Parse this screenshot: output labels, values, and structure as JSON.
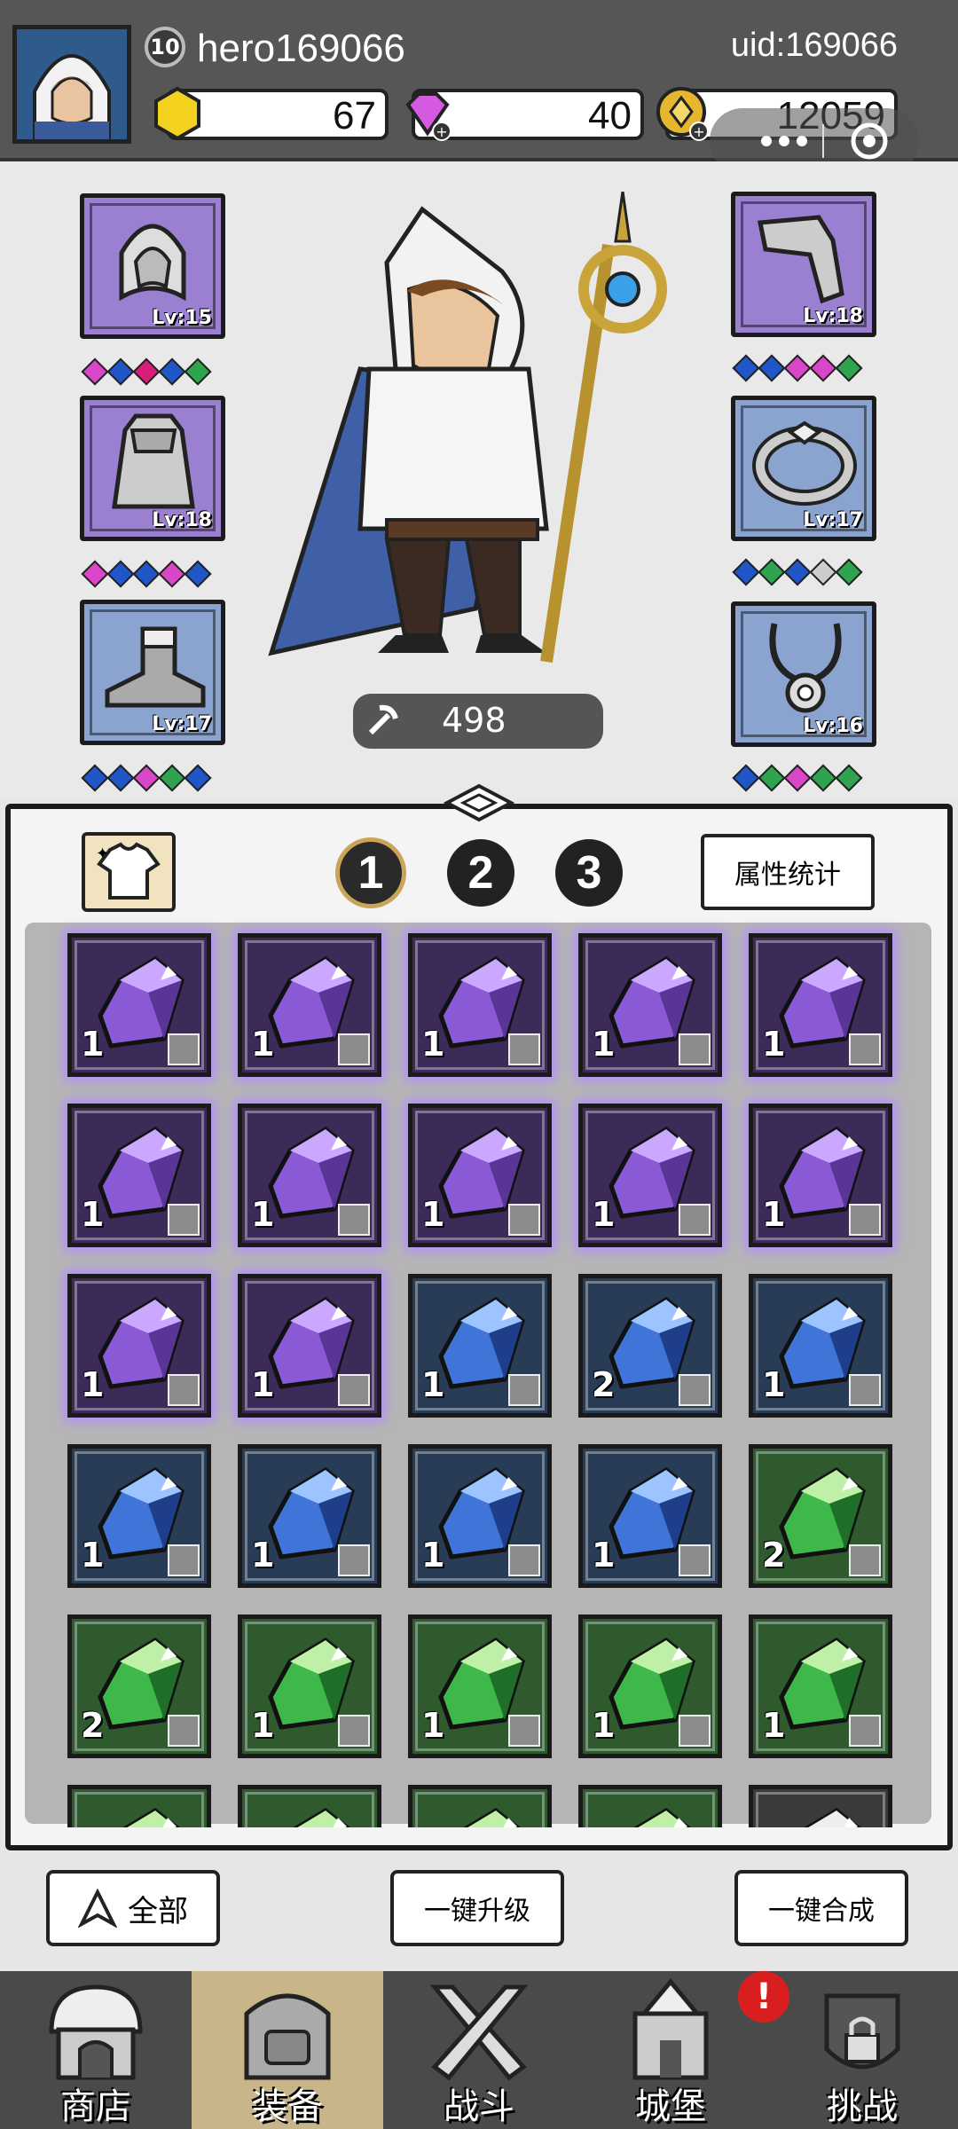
{
  "player": {
    "level": "10",
    "name": "hero169066",
    "uid": "uid:169066"
  },
  "resources": {
    "gold": "67",
    "gems": "40",
    "coins": "12059"
  },
  "equipment": {
    "left": [
      {
        "name": "hood",
        "level": "Lv:15",
        "gems": [
          "#d946c7",
          "#2156c9",
          "#d91e7a",
          "#2156c9",
          "#2ea44f"
        ]
      },
      {
        "name": "cape",
        "level": "Lv:18",
        "gems": [
          "#d946c7",
          "#2156c9",
          "#2156c9",
          "#d946c7",
          "#2156c9"
        ]
      },
      {
        "name": "boots",
        "level": "Lv:17",
        "gems": [
          "#2156c9",
          "#2156c9",
          "#d946c7",
          "#2ea44f",
          "#2156c9"
        ]
      }
    ],
    "right": [
      {
        "name": "gloves",
        "level": "Lv:18",
        "gems": [
          "#2156c9",
          "#2156c9",
          "#d946c7",
          "#d946c7",
          "#2ea44f"
        ]
      },
      {
        "name": "ring",
        "level": "Lv:17",
        "gems": [
          "#2156c9",
          "#2ea44f",
          "#2156c9",
          "#cccccc",
          "#2ea44f"
        ]
      },
      {
        "name": "necklace",
        "level": "Lv:16",
        "gems": [
          "#2156c9",
          "#2ea44f",
          "#d946c7",
          "#2ea44f",
          "#2ea44f"
        ]
      }
    ]
  },
  "power": "498",
  "tabs": [
    "1",
    "2",
    "3"
  ],
  "stats_button": "属性统计",
  "inventory": [
    {
      "rarity": "purple",
      "count": "1",
      "type": "hood"
    },
    {
      "rarity": "purple",
      "count": "1",
      "type": "cape"
    },
    {
      "rarity": "purple",
      "count": "1",
      "type": "cape"
    },
    {
      "rarity": "purple",
      "count": "1",
      "type": "boots"
    },
    {
      "rarity": "purple",
      "count": "1",
      "type": "boots"
    },
    {
      "rarity": "purple",
      "count": "1",
      "type": "gloves"
    },
    {
      "rarity": "purple",
      "count": "1",
      "type": "ring"
    },
    {
      "rarity": "purple",
      "count": "1",
      "type": "ring"
    },
    {
      "rarity": "purple",
      "count": "1",
      "type": "ring"
    },
    {
      "rarity": "purple",
      "count": "1",
      "type": "ring"
    },
    {
      "rarity": "purple",
      "count": "1",
      "type": "necklace"
    },
    {
      "rarity": "purple",
      "count": "1",
      "type": "necklace"
    },
    {
      "rarity": "blue",
      "count": "1",
      "type": "hood"
    },
    {
      "rarity": "blue",
      "count": "2",
      "type": "hood"
    },
    {
      "rarity": "blue",
      "count": "1",
      "type": "boots"
    },
    {
      "rarity": "blue",
      "count": "1",
      "type": "ring"
    },
    {
      "rarity": "blue",
      "count": "1",
      "type": "ring"
    },
    {
      "rarity": "blue",
      "count": "1",
      "type": "ring"
    },
    {
      "rarity": "blue",
      "count": "1",
      "type": "necklace"
    },
    {
      "rarity": "green",
      "count": "2",
      "type": "hood"
    },
    {
      "rarity": "green",
      "count": "2",
      "type": "hood"
    },
    {
      "rarity": "green",
      "count": "1",
      "type": "boots"
    },
    {
      "rarity": "green",
      "count": "1",
      "type": "boots"
    },
    {
      "rarity": "green",
      "count": "1",
      "type": "boots"
    },
    {
      "rarity": "green",
      "count": "1",
      "type": "boots"
    },
    {
      "rarity": "green",
      "count": "",
      "type": ""
    },
    {
      "rarity": "green",
      "count": "",
      "type": ""
    },
    {
      "rarity": "green",
      "count": "",
      "type": ""
    },
    {
      "rarity": "green",
      "count": "",
      "type": ""
    },
    {
      "rarity": "gray",
      "count": "",
      "type": ""
    }
  ],
  "actions": {
    "filter": "全部",
    "upgrade_all": "一键升级",
    "merge_all": "一键合成"
  },
  "nav": [
    {
      "label": "商店",
      "icon": "shop-icon"
    },
    {
      "label": "装备",
      "icon": "backpack-icon"
    },
    {
      "label": "战斗",
      "icon": "crossed-swords-icon"
    },
    {
      "label": "城堡",
      "icon": "castle-icon"
    },
    {
      "label": "挑战",
      "icon": "locked-knight-icon"
    }
  ],
  "alert_badge": "!",
  "colors": {
    "purple": "#9b7fd1",
    "blue": "#8aa3cf",
    "green": "#2e5a2e",
    "accent_gold": "#c9a45a"
  }
}
